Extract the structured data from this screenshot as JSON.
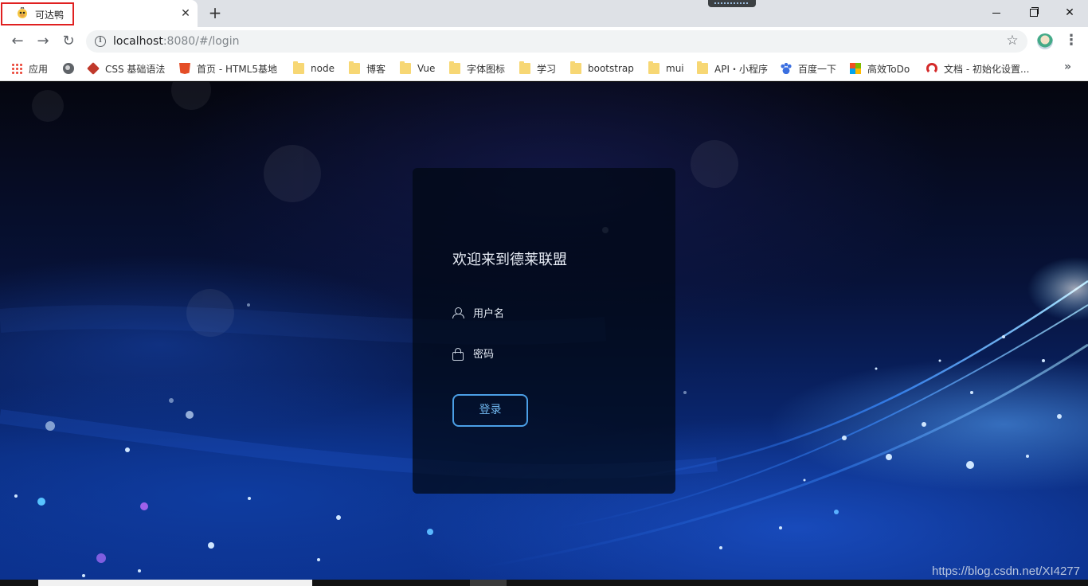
{
  "browser": {
    "tab": {
      "title": "可达鸭",
      "close": "✕"
    },
    "new_tab": "+",
    "url": {
      "host": "localhost",
      "rest": ":8080/#/login"
    },
    "nav": {
      "back": "←",
      "forward": "→",
      "reload": "↻"
    },
    "star": "☆",
    "menu": "⋮",
    "bookmarks_more": "»",
    "bookmarks": [
      {
        "label": "应用",
        "icon": "apps-icon"
      },
      {
        "label": "",
        "icon": "globe-icon"
      },
      {
        "label": "CSS 基础语法",
        "icon": "css-icon"
      },
      {
        "label": "首页 - HTML5基地",
        "icon": "html5-icon"
      },
      {
        "label": "node",
        "icon": "folder-icon"
      },
      {
        "label": "博客",
        "icon": "folder-icon"
      },
      {
        "label": "Vue",
        "icon": "folder-icon"
      },
      {
        "label": "字体图标",
        "icon": "folder-icon"
      },
      {
        "label": "学习",
        "icon": "folder-icon"
      },
      {
        "label": "bootstrap",
        "icon": "folder-icon"
      },
      {
        "label": "mui",
        "icon": "folder-icon"
      },
      {
        "label": "API・小程序",
        "icon": "folder-icon"
      },
      {
        "label": "百度一下",
        "icon": "baidu-paw-icon"
      },
      {
        "label": "高效ToDo",
        "icon": "microsoft-icon"
      },
      {
        "label": "文档 - 初始化设置...",
        "icon": "arc-icon"
      }
    ]
  },
  "login": {
    "title": "欢迎来到德莱联盟",
    "username_placeholder": "用户名",
    "password_placeholder": "密码",
    "submit_label": "登录"
  },
  "watermark": "https://blog.csdn.net/XI4277",
  "colors": {
    "button_border": "#4b9fe6",
    "button_text": "#6fb6ee",
    "tab_highlight": "#e02020"
  }
}
